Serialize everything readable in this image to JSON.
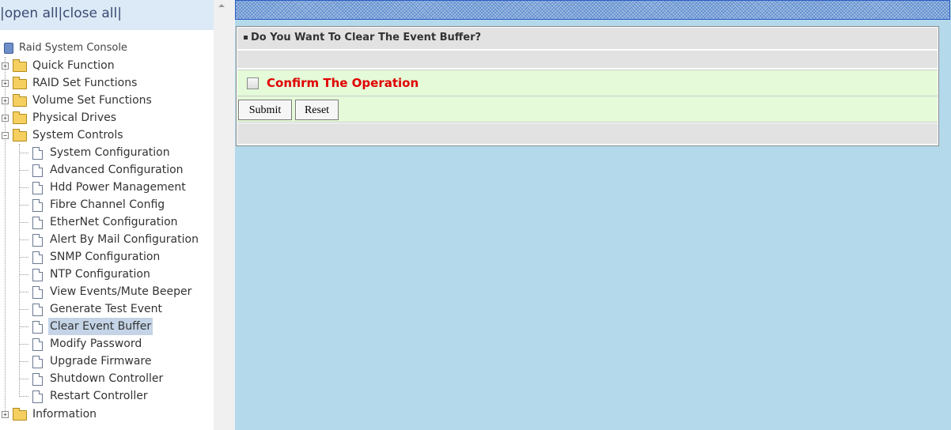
{
  "toolbar": {
    "sep1": "|",
    "open_all": "open all",
    "sep2": "|",
    "close_all": "close all",
    "sep3": "|"
  },
  "tree": {
    "root": "Raid System Console",
    "items": [
      {
        "label": "Quick Function",
        "expanded": false
      },
      {
        "label": "RAID Set Functions",
        "expanded": false
      },
      {
        "label": "Volume Set Functions",
        "expanded": false
      },
      {
        "label": "Physical Drives",
        "expanded": false
      },
      {
        "label": "System Controls",
        "expanded": true
      }
    ],
    "system_controls_children": [
      "System Configuration",
      "Advanced Configuration",
      "Hdd Power Management",
      "Fibre Channel Config",
      "EtherNet Configuration",
      "Alert By Mail Configuration",
      "SNMP Configuration",
      "NTP Configuration",
      "View Events/Mute Beeper",
      "Generate Test Event",
      "Clear Event Buffer",
      "Modify Password",
      "Upgrade Firmware",
      "Shutdown Controller",
      "Restart Controller"
    ],
    "selected": "Clear Event Buffer",
    "information": "Information"
  },
  "form": {
    "title": "Do You Want To Clear The Event Buffer?",
    "confirm_label": "Confirm The Operation",
    "confirm_checked": false,
    "submit_label": "Submit",
    "reset_label": "Reset"
  },
  "colors": {
    "tree_header_bg": "#dce9f7",
    "content_bg": "#b3d9ea",
    "confirm_text": "#e00000",
    "row_green": "#e4fad8",
    "row_gray": "#e2e2e2"
  },
  "icons": {
    "root": "console-icon",
    "folder": "folder-icon",
    "page": "page-icon",
    "expander": "plus-minus-icon"
  }
}
